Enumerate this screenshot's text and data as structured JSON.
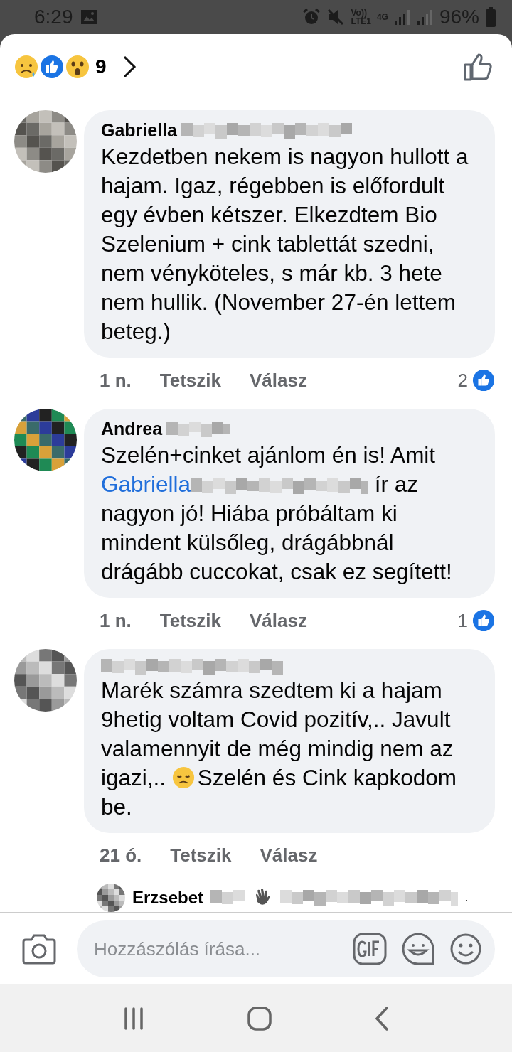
{
  "status_bar": {
    "time": "6:29",
    "volte_top": "Vo))",
    "volte_bottom": "LTE1",
    "network": "4G",
    "battery": "96%"
  },
  "reactions": {
    "count": "9"
  },
  "comments": [
    {
      "author": "Gabriella",
      "author_blurred": true,
      "body": [
        {
          "kind": "text",
          "text": "Kezdetben nekem is nagyon hullott a hajam. Igaz, régebben is előfordult egy évben kétszer. Elkezdtem Bio Szelenium + cink tablettát szedni, nem vényköteles, s már kb. 3 hete nem hullik. (November 27-én lettem beteg.)"
        }
      ],
      "time": "1 n.",
      "like": "Tetszik",
      "reply": "Válasz",
      "like_count": "2"
    },
    {
      "author": "Andrea",
      "author_blurred": true,
      "body": [
        {
          "kind": "text",
          "text": "Szelén+cinket ajánlom én is! Amit "
        },
        {
          "kind": "mention",
          "text": "Gabriella"
        },
        {
          "kind": "blur"
        },
        {
          "kind": "text",
          "text": " ír az nagyon jó! Hiába próbáltam ki mindent külsőleg, drágábbnál drágább cuccokat, csak ez segített!"
        }
      ],
      "time": "1 n.",
      "like": "Tetszik",
      "reply": "Válasz",
      "like_count": "1"
    },
    {
      "author_blurred": true,
      "body": [
        {
          "kind": "text",
          "text": "Marék számra szedtem ki a hajam 9hetig voltam Covid pozitív,.. Javult valamennyit de még mindig nem az igazi,.. "
        },
        {
          "kind": "emoji"
        },
        {
          "kind": "text",
          "text": "Szelén és Cink kapkodom be."
        }
      ],
      "time": "21 ó.",
      "like": "Tetszik",
      "reply": "Válasz"
    }
  ],
  "reply_preview": {
    "author": "Erzsebet",
    "end": "."
  },
  "composer": {
    "placeholder": "Hozzászólás írása..."
  }
}
